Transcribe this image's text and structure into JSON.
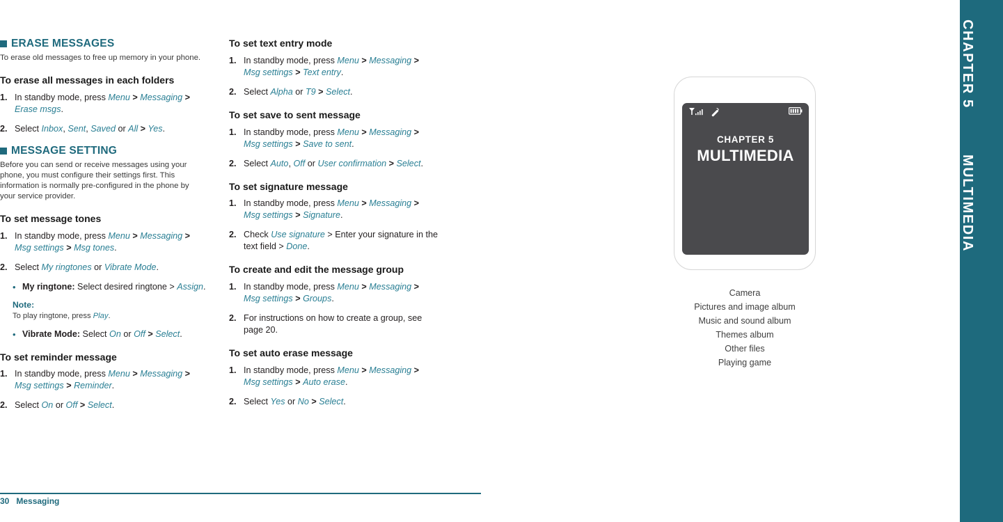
{
  "page": {
    "footer_page_number": "30",
    "footer_section": "Messaging",
    "accent_teal": "#1f6a7d",
    "menu_item_teal": "#2a7f94",
    "screen_gray": "#4a4a4d"
  },
  "chapter_sidebar": {
    "chapter_number": "CHAPTER 5",
    "chapter_title": "MULTIMEDIA"
  },
  "left_column": {
    "section1": {
      "heading": "ERASE MESSAGES",
      "intro": "To erase old messages to free up memory in your phone.",
      "sub1": {
        "title": "To erase all messages in each folders",
        "steps": [
          {
            "num": "1.",
            "lead": "In standby mode, press ",
            "path": [
              "Menu",
              "Messaging",
              "Erase msgs"
            ],
            "tail": "."
          },
          {
            "num": "2.",
            "lead": "Select ",
            "options": [
              "Inbox",
              "Sent",
              "Saved"
            ],
            "or_label": " or ",
            "last_option": "All",
            "sep": " > ",
            "final": "Yes",
            "tail": "."
          }
        ]
      }
    },
    "section2": {
      "heading": "MESSAGE SETTING",
      "intro": "Before you can send or receive messages using your phone, you must configure their settings first. This information is normally pre-configured in the phone by your service provider.",
      "sub1": {
        "title": "To set message tones",
        "step1": {
          "num": "1.",
          "lead": "In standby mode, press ",
          "path": [
            "Menu",
            "Messaging",
            "Msg settings",
            "Msg tones"
          ],
          "tail": "."
        },
        "step2": {
          "num": "2.",
          "lead": "Select ",
          "opt_a": "My ringtones",
          "or_label": " or ",
          "opt_b": "Vibrate Mode",
          "tail": "."
        },
        "bullet1": {
          "mark": "•",
          "label": "My ringtone:",
          "text": " Select desired ringtone > ",
          "action": "Assign",
          "tail": "."
        },
        "note": {
          "title": "Note:",
          "body_lead": "To play ringtone, press ",
          "body_action": "Play",
          "body_tail": "."
        },
        "bullet2": {
          "mark": "•",
          "label": "Vibrate Mode:",
          "text": " Select ",
          "opt_a": "On",
          "or_label": " or ",
          "opt_b": "Off",
          "sep": " > ",
          "action": "Select",
          "tail": "."
        }
      },
      "sub2": {
        "title": "To set reminder message",
        "step1": {
          "num": "1.",
          "lead": "In standby mode, press ",
          "path": [
            "Menu",
            "Messaging",
            "Msg settings",
            "Reminder"
          ],
          "tail": "."
        },
        "step2": {
          "num": "2.",
          "lead": "Select ",
          "opt_a": "On",
          "or_label": " or ",
          "opt_b": "Off",
          "sep": " > ",
          "action": "Select",
          "tail": "."
        }
      }
    }
  },
  "mid_column": {
    "sub1": {
      "title": "To set text entry mode",
      "step1": {
        "num": "1.",
        "lead": "In standby mode, press ",
        "path": [
          "Menu",
          "Messaging",
          "Msg settings",
          "Text entry"
        ],
        "tail": "."
      },
      "step2": {
        "num": "2.",
        "lead": "Select ",
        "opt_a": "Alpha",
        "or_label": " or ",
        "opt_b": "T9",
        "sep": " > ",
        "action": "Select",
        "tail": "."
      }
    },
    "sub2": {
      "title": "To set save to sent message",
      "step1": {
        "num": "1.",
        "lead": "In standby mode, press ",
        "path": [
          "Menu",
          "Messaging",
          "Msg settings",
          "Save to sent"
        ],
        "tail": "."
      },
      "step2": {
        "num": "2.",
        "lead": "Select ",
        "opt_a": "Auto",
        "comma": ", ",
        "opt_b": "Off",
        "or_label": " or ",
        "opt_c": "User confirmation",
        "sep": " > ",
        "action": "Select",
        "tail": "."
      }
    },
    "sub3": {
      "title": "To set signature message",
      "step1": {
        "num": "1.",
        "lead": "In standby mode, press ",
        "path": [
          "Menu",
          "Messaging",
          "Msg settings",
          "Signature"
        ],
        "tail": "."
      },
      "step2": {
        "num": "2.",
        "lead": "Check ",
        "opt_a": "Use signature",
        "middle": " > Enter your signature in the text field > ",
        "action": "Done",
        "tail": "."
      }
    },
    "sub4": {
      "title": "To create and edit the message group",
      "step1": {
        "num": "1.",
        "lead": "In standby mode, press ",
        "path": [
          "Menu",
          "Messaging",
          "Msg settings",
          "Groups"
        ],
        "tail": "."
      },
      "step2": {
        "num": "2.",
        "text": "For instructions on how to create a group, see page 20."
      }
    },
    "sub5": {
      "title": "To set auto erase message",
      "step1": {
        "num": "1.",
        "lead": "In standby mode, press ",
        "path": [
          "Menu",
          "Messaging",
          "Msg settings",
          "Auto erase"
        ],
        "tail": "."
      },
      "step2": {
        "num": "2.",
        "lead": "Select ",
        "opt_a": "Yes",
        "or_label": " or ",
        "opt_b": "No",
        "sep": " > ",
        "action": "Select",
        "tail": "."
      }
    }
  },
  "phone_figure": {
    "screen_chapter": "CHAPTER 5",
    "screen_title": "MULTIMEDIA",
    "status_icons": [
      "signal-antenna-icon",
      "call-handset-icon",
      "battery-icon"
    ],
    "caption_items": [
      "Camera",
      "Pictures and image album",
      "Music and sound album",
      "Themes album",
      "Other files",
      "Playing game"
    ]
  }
}
